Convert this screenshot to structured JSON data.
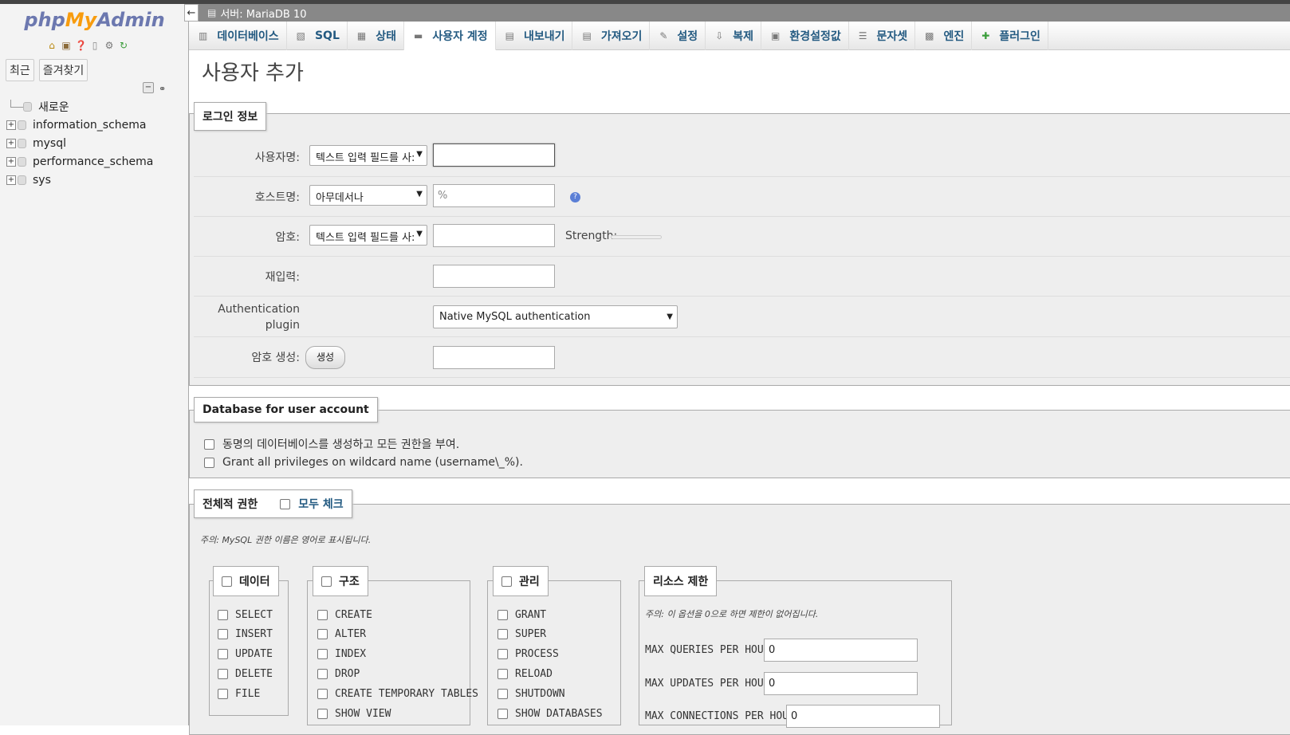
{
  "nav": {
    "logo_php": "php",
    "logo_my": "My",
    "logo_admin": "Admin",
    "tab_recent": "최근",
    "tab_favorites": "즐겨찾기",
    "tree": [
      {
        "label": "새로운",
        "type": "new"
      },
      {
        "label": "information_schema",
        "type": "db"
      },
      {
        "label": "mysql",
        "type": "db"
      },
      {
        "label": "performance_schema",
        "type": "db"
      },
      {
        "label": "sys",
        "type": "db"
      }
    ]
  },
  "serverbar": {
    "back": "←",
    "title": "서버: MariaDB 10"
  },
  "tabs": [
    {
      "label": "데이터베이스",
      "icon": "database-icon"
    },
    {
      "label": "SQL",
      "icon": "sql-icon"
    },
    {
      "label": "상태",
      "icon": "status-icon"
    },
    {
      "label": "사용자 계정",
      "icon": "users-icon",
      "active": true
    },
    {
      "label": "내보내기",
      "icon": "export-icon"
    },
    {
      "label": "가져오기",
      "icon": "import-icon"
    },
    {
      "label": "설정",
      "icon": "wrench-icon"
    },
    {
      "label": "복제",
      "icon": "replication-icon"
    },
    {
      "label": "환경설정값",
      "icon": "variables-icon"
    },
    {
      "label": "문자셋",
      "icon": "charset-icon"
    },
    {
      "label": "엔진",
      "icon": "engine-icon"
    },
    {
      "label": "플러그인",
      "icon": "plugin-icon"
    }
  ],
  "page": {
    "title": "사용자 추가"
  },
  "login": {
    "legend": "로그인 정보",
    "username_label": "사용자명:",
    "username_select": "텍스트 입력 필드를 사:",
    "username_value": "",
    "host_label": "호스트명:",
    "host_select": "아무데서나",
    "host_value": "%",
    "password_label": "암호:",
    "password_select": "텍스트 입력 필드를 사:",
    "strength_label": "Strength:",
    "strength_level": 0,
    "reenter_label": "재입력:",
    "auth_label_1": "Authentication",
    "auth_label_2": "plugin",
    "auth_select": "Native MySQL authentication",
    "generate_label": "암호 생성:",
    "generate_button": "생성"
  },
  "dbaccount": {
    "legend": "Database for user account",
    "opt1": "동명의 데이터베이스를 생성하고 모든 권한을 부여.",
    "opt2": "Grant all privileges on wildcard name (username\\_%)."
  },
  "global": {
    "legend": "전체적 권한",
    "check_all": "모두 체크",
    "note": "주의: MySQL 권한 이름은 영어로 표시됩니다.",
    "data": {
      "legend": "데이터",
      "items": [
        "SELECT",
        "INSERT",
        "UPDATE",
        "DELETE",
        "FILE"
      ]
    },
    "structure": {
      "legend": "구조",
      "items": [
        "CREATE",
        "ALTER",
        "INDEX",
        "DROP",
        "CREATE TEMPORARY TABLES",
        "SHOW VIEW"
      ]
    },
    "admin": {
      "legend": "관리",
      "items": [
        "GRANT",
        "SUPER",
        "PROCESS",
        "RELOAD",
        "SHUTDOWN",
        "SHOW DATABASES"
      ]
    },
    "resource": {
      "legend": "리소스 제한",
      "note": "주의: 이 옵션을 0으로 하면 제한이 없어집니다.",
      "q_label": "MAX QUERIES PER HOUR",
      "q_value": "0",
      "u_label": "MAX UPDATES PER HOUR",
      "u_value": "0",
      "c_label": "MAX CONNECTIONS PER HOUR",
      "c_value": "0"
    }
  }
}
